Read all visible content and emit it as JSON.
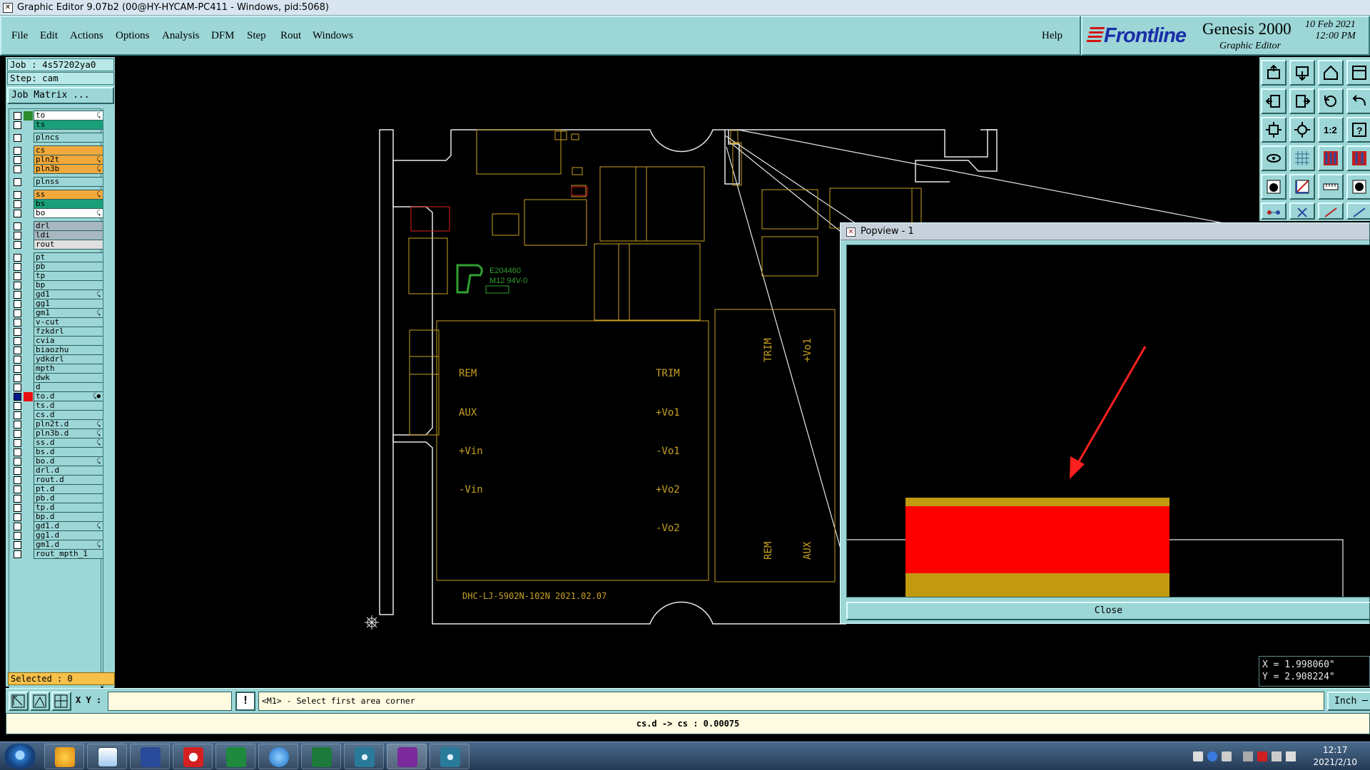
{
  "window": {
    "title": "Graphic Editor 9.07b2 (00@HY-HYCAM-PC411 - Windows, pid:5068)"
  },
  "menu": [
    {
      "label": "File",
      "name": "menu-file"
    },
    {
      "label": "Edit",
      "name": "menu-edit"
    },
    {
      "label": "Actions",
      "name": "menu-actions"
    },
    {
      "label": "Options",
      "name": "menu-options"
    },
    {
      "label": "Analysis",
      "name": "menu-analysis"
    },
    {
      "label": "DFM",
      "name": "menu-dfm"
    },
    {
      "label": "Step",
      "name": "menu-step"
    },
    {
      "label": "Rout",
      "name": "menu-rout"
    },
    {
      "label": "Windows",
      "name": "menu-windows"
    }
  ],
  "help_label": "Help",
  "brand": {
    "logo": "Frontline",
    "product": "Genesis 2000",
    "subtitle": "Graphic Editor",
    "date": "10 Feb 2021\n12:00 PM"
  },
  "job": {
    "job": "Job : 4s57202ya0",
    "step": "Step: cam",
    "matrix_button": "Job Matrix ..."
  },
  "layers": [
    {
      "name": "to",
      "color": "#ffffff",
      "swatch": "#2e8b2e",
      "flag": "⤹"
    },
    {
      "name": "ts",
      "color": "#1aa079"
    },
    {
      "name": "plncs",
      "color": "#9cd6d6",
      "gap": true
    },
    {
      "name": "cs",
      "color": "#f2a93b",
      "gap": true
    },
    {
      "name": "pln2t",
      "color": "#f2a93b",
      "flag": "⤹"
    },
    {
      "name": "pln3b",
      "color": "#f2a93b",
      "flag": "⤹"
    },
    {
      "name": "plnss",
      "color": "#9cd6d6",
      "gap": true
    },
    {
      "name": "ss",
      "color": "#f2a93b",
      "gap": true,
      "flag": "⤹"
    },
    {
      "name": "bs",
      "color": "#1aa079"
    },
    {
      "name": "bo",
      "color": "#ffffff",
      "flag": "⤹"
    },
    {
      "name": "drl",
      "color": "#a8b8c0",
      "gap": true
    },
    {
      "name": "ldi",
      "color": "#a8b8c0"
    },
    {
      "name": "rout",
      "color": "#e0e0e0"
    },
    {
      "name": "pt",
      "color": "#9cd6d6",
      "gap": true
    },
    {
      "name": "pb",
      "color": "#9cd6d6"
    },
    {
      "name": "tp",
      "color": "#9cd6d6"
    },
    {
      "name": "bp",
      "color": "#9cd6d6"
    },
    {
      "name": "gd1",
      "color": "#9cd6d6",
      "flag": "⤹"
    },
    {
      "name": "gg1",
      "color": "#9cd6d6"
    },
    {
      "name": "gm1",
      "color": "#9cd6d6",
      "flag": "⤹"
    },
    {
      "name": "v-cut",
      "color": "#9cd6d6"
    },
    {
      "name": "fzkdrl",
      "color": "#9cd6d6"
    },
    {
      "name": "cvia",
      "color": "#9cd6d6"
    },
    {
      "name": "biaozhu",
      "color": "#9cd6d6"
    },
    {
      "name": "ydkdrl",
      "color": "#9cd6d6"
    },
    {
      "name": "mpth",
      "color": "#9cd6d6"
    },
    {
      "name": "dwk",
      "color": "#9cd6d6"
    },
    {
      "name": "d",
      "color": "#9cd6d6"
    },
    {
      "name": "to.d",
      "color": "#9cd6d6",
      "active": true,
      "swatch": "#e81010",
      "flag": "⤹●"
    },
    {
      "name": "ts.d",
      "color": "#9cd6d6"
    },
    {
      "name": "cs.d",
      "color": "#9cd6d6"
    },
    {
      "name": "pln2t.d",
      "color": "#9cd6d6",
      "flag": "⤹"
    },
    {
      "name": "pln3b.d",
      "color": "#9cd6d6",
      "flag": "⤹"
    },
    {
      "name": "ss.d",
      "color": "#9cd6d6",
      "flag": "⤹"
    },
    {
      "name": "bs.d",
      "color": "#9cd6d6"
    },
    {
      "name": "bo.d",
      "color": "#9cd6d6",
      "flag": "⤹"
    },
    {
      "name": "drl.d",
      "color": "#9cd6d6"
    },
    {
      "name": "rout.d",
      "color": "#9cd6d6"
    },
    {
      "name": "pt.d",
      "color": "#9cd6d6"
    },
    {
      "name": "pb.d",
      "color": "#9cd6d6"
    },
    {
      "name": "tp.d",
      "color": "#9cd6d6"
    },
    {
      "name": "bp.d",
      "color": "#9cd6d6"
    },
    {
      "name": "gd1.d",
      "color": "#9cd6d6",
      "flag": "⤹"
    },
    {
      "name": "gg1.d",
      "color": "#9cd6d6"
    },
    {
      "name": "gm1.d",
      "color": "#9cd6d6",
      "flag": "⤹"
    },
    {
      "name": "rout_mpth_1",
      "color": "#9cd6d6"
    }
  ],
  "selected": "Selected : 0",
  "board_text": {
    "rem": "REM",
    "trim": "TRIM",
    "aux": "AUX",
    "vin_plus": "+Vin",
    "vin_minus": "-Vin",
    "vo1_plus": "+Vo1",
    "vo1_minus": "-Vo1",
    "vo2_plus": "+Vo2",
    "vo2_minus": "-Vo2",
    "part_number": "DHC-LJ-5902N-102N 2021.02.07",
    "ul_line1": "E204460",
    "ul_line2": "M12 94V-0",
    "rot_trim": "TRIM",
    "rot_vo1": "+Vo1",
    "rot_rem": "REM",
    "rot_aux": "AUX"
  },
  "popview": {
    "title": "Popview - 1",
    "close_label": "Close"
  },
  "coords": {
    "x": "X = 1.998060\"",
    "y": "Y = 2.908224\""
  },
  "cmd": {
    "xy_label": "X Y :",
    "xy_value": "",
    "prompt": "<M1> - Select first area corner",
    "units": "Inch ─"
  },
  "status": "cs.d -> cs : 0.00075",
  "taskbar": {
    "time": "12:17",
    "date": "2021/2/10"
  },
  "colors": {
    "panel": "#9cd6d6",
    "board_outline": "#e8e8e8",
    "copper": "#c8a020",
    "highlight": "#ff0000",
    "arrow": "#ff2020"
  }
}
